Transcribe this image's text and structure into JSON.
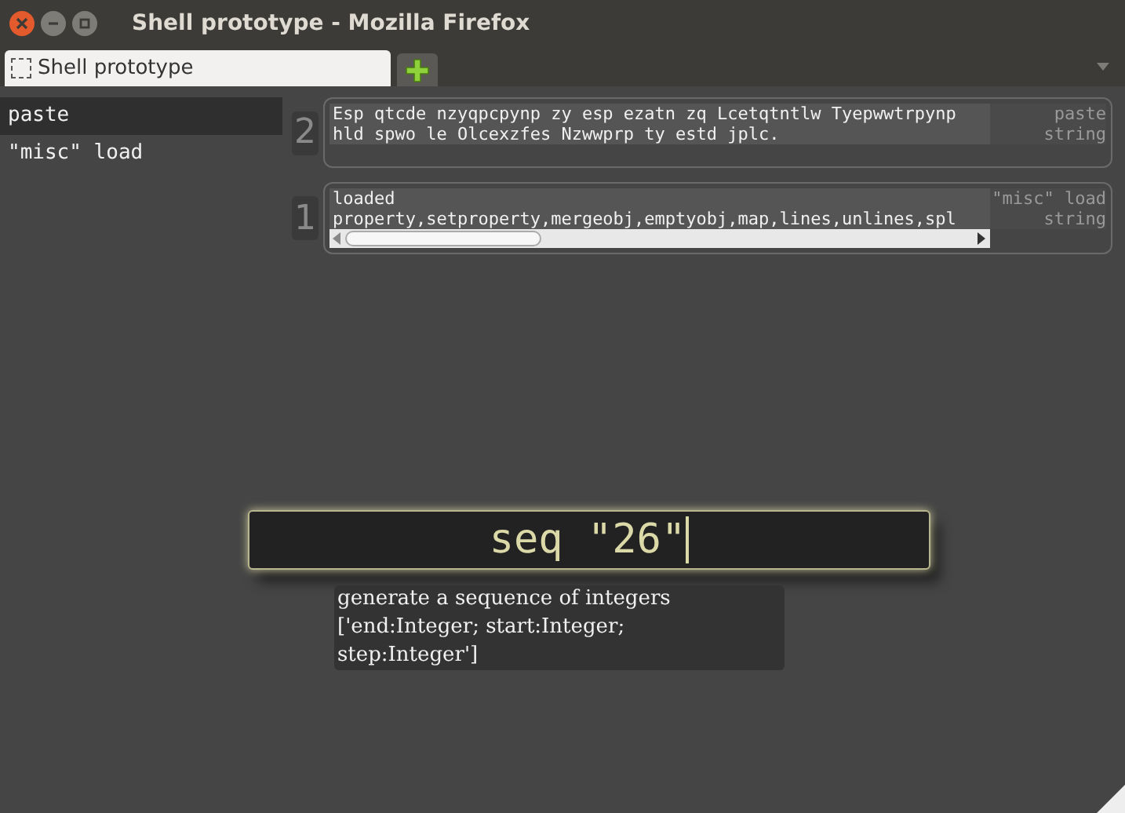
{
  "window": {
    "title": "Shell prototype - Mozilla Firefox"
  },
  "tabs": [
    {
      "label": "Shell prototype",
      "selected": true
    }
  ],
  "history": [
    {
      "label": "paste",
      "selected": true
    },
    {
      "label": "\"misc\" load",
      "selected": false
    }
  ],
  "results": [
    {
      "index": "2",
      "lines": [
        "Esp qtcde nzyqpcpynp zy esp ezatn zq Lcetqtntlw Tyepwwtrpynp",
        "hld spwo le Olcexzfes Nzwwprp ty estd jplc."
      ],
      "command": "paste",
      "type": "string",
      "kind": "text"
    },
    {
      "index": "1",
      "lines": [
        "loaded",
        "property,setproperty,mergeobj,emptyobj,map,lines,unlines,spl"
      ],
      "command": "\"misc\" load",
      "type": "string",
      "kind": "scroll"
    }
  ],
  "command": {
    "value": "seq \"26\""
  },
  "tooltip": {
    "lines": [
      "generate a sequence of integers",
      "['end:Integer; start:Integer;",
      "step:Integer']"
    ]
  }
}
